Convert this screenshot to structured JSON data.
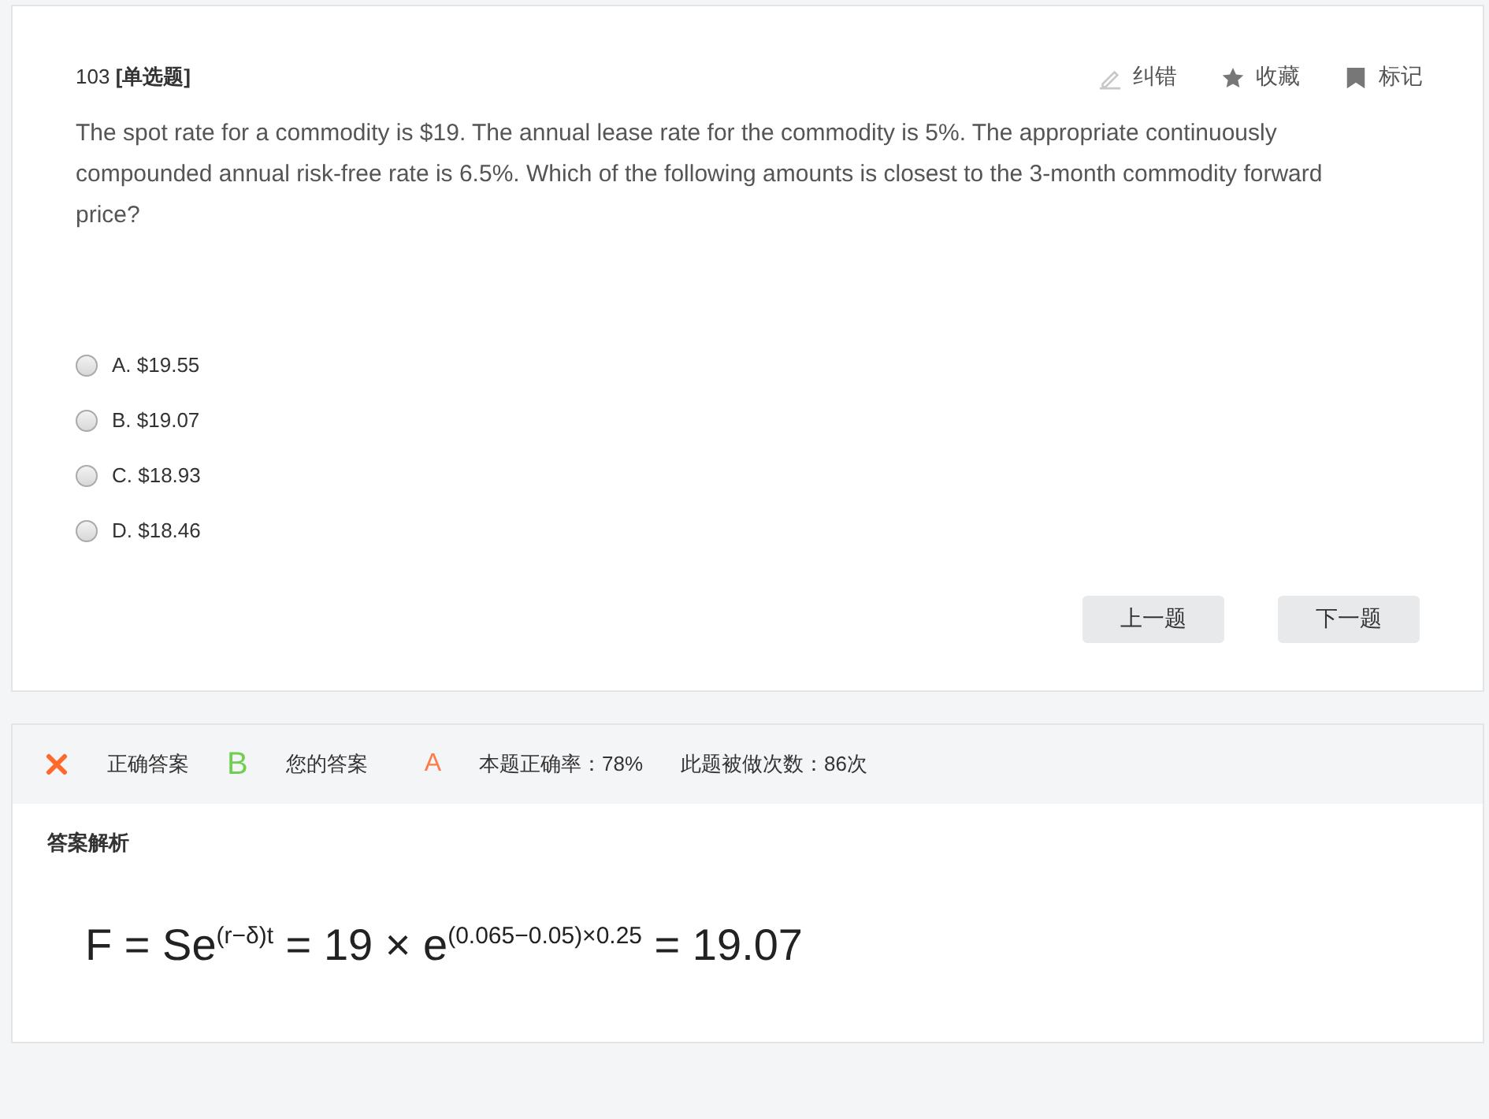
{
  "question": {
    "number": "103",
    "type": "[单选题]",
    "actions": [
      {
        "kind": "correct",
        "label": "纠错"
      },
      {
        "kind": "favorite",
        "label": "收藏"
      },
      {
        "kind": "mark",
        "label": "标记"
      }
    ],
    "text": "The spot rate for a commodity is $19. The annual lease rate for the commodity is 5%. The appropriate continuously compounded annual risk-free rate is 6.5%. Which of the following amounts is closest to the 3-month commodity forward price?",
    "options": [
      {
        "label": "A. $19.55",
        "selected": false
      },
      {
        "label": "B. $19.07",
        "selected": false
      },
      {
        "label": "C. $18.93",
        "selected": false
      },
      {
        "label": "D. $18.46",
        "selected": false
      }
    ],
    "nav_buttons": [
      "上一题",
      "下一题"
    ]
  },
  "result": {
    "correct": false,
    "correct_label": "正确答案",
    "correct_answer": "B",
    "your_label": "您的答案",
    "your_answer": "A",
    "accuracy": "本题正确率：78%",
    "attempts": "此题被做次数：86次"
  },
  "analysis": {
    "title": "答案解析",
    "formula": "F = Se$^{(r−δ)t}$ = 19 × e$^{(0.065−0.05)×0.25}$ = 19.07"
  }
}
